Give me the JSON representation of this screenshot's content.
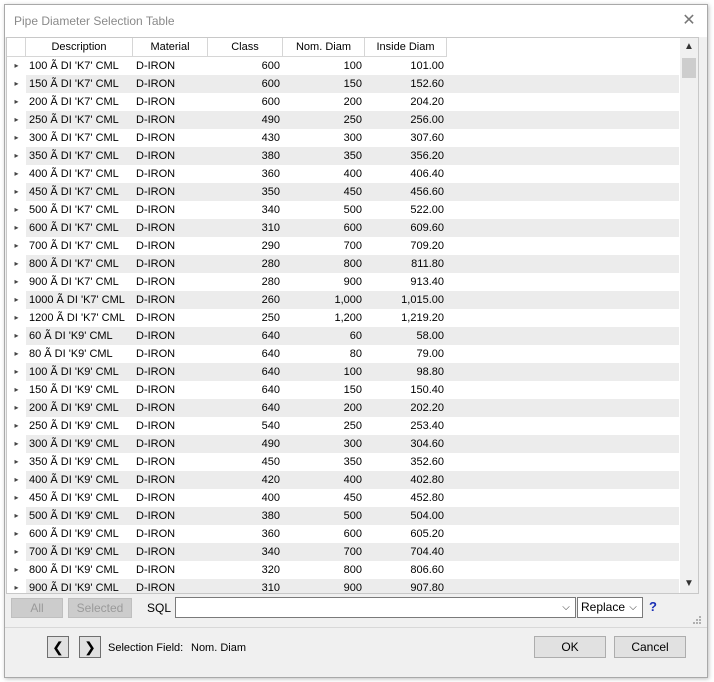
{
  "window": {
    "title": "Pipe Diameter Selection Table",
    "close_glyph": "✕"
  },
  "grid": {
    "columns": [
      "Description",
      "Material",
      "Class",
      "Nom. Diam",
      "Inside Diam"
    ],
    "row_indicator": "▸",
    "rows": [
      {
        "description": "100 Ã DI 'K7' CML",
        "material": "D-IRON",
        "class": "600",
        "nom_diam": "100",
        "inside_diam": "101.00"
      },
      {
        "description": "150 Ã DI 'K7' CML",
        "material": "D-IRON",
        "class": "600",
        "nom_diam": "150",
        "inside_diam": "152.60"
      },
      {
        "description": "200 Ã DI 'K7' CML",
        "material": "D-IRON",
        "class": "600",
        "nom_diam": "200",
        "inside_diam": "204.20"
      },
      {
        "description": "250 Ã DI 'K7' CML",
        "material": "D-IRON",
        "class": "490",
        "nom_diam": "250",
        "inside_diam": "256.00"
      },
      {
        "description": "300 Ã DI 'K7' CML",
        "material": "D-IRON",
        "class": "430",
        "nom_diam": "300",
        "inside_diam": "307.60"
      },
      {
        "description": "350 Ã DI 'K7' CML",
        "material": "D-IRON",
        "class": "380",
        "nom_diam": "350",
        "inside_diam": "356.20"
      },
      {
        "description": "400 Ã DI 'K7' CML",
        "material": "D-IRON",
        "class": "360",
        "nom_diam": "400",
        "inside_diam": "406.40"
      },
      {
        "description": "450 Ã DI 'K7' CML",
        "material": "D-IRON",
        "class": "350",
        "nom_diam": "450",
        "inside_diam": "456.60"
      },
      {
        "description": "500 Ã DI 'K7' CML",
        "material": "D-IRON",
        "class": "340",
        "nom_diam": "500",
        "inside_diam": "522.00"
      },
      {
        "description": "600 Ã DI 'K7' CML",
        "material": "D-IRON",
        "class": "310",
        "nom_diam": "600",
        "inside_diam": "609.60"
      },
      {
        "description": "700 Ã DI 'K7' CML",
        "material": "D-IRON",
        "class": "290",
        "nom_diam": "700",
        "inside_diam": "709.20"
      },
      {
        "description": "800 Ã DI 'K7' CML",
        "material": "D-IRON",
        "class": "280",
        "nom_diam": "800",
        "inside_diam": "811.80"
      },
      {
        "description": "900 Ã DI 'K7' CML",
        "material": "D-IRON",
        "class": "280",
        "nom_diam": "900",
        "inside_diam": "913.40"
      },
      {
        "description": "1000 Ã DI 'K7' CML",
        "material": "D-IRON",
        "class": "260",
        "nom_diam": "1,000",
        "inside_diam": "1,015.00"
      },
      {
        "description": "1200 Ã DI 'K7' CML",
        "material": "D-IRON",
        "class": "250",
        "nom_diam": "1,200",
        "inside_diam": "1,219.20"
      },
      {
        "description": "60 Ã DI 'K9' CML",
        "material": "D-IRON",
        "class": "640",
        "nom_diam": "60",
        "inside_diam": "58.00"
      },
      {
        "description": "80 Ã DI 'K9' CML",
        "material": "D-IRON",
        "class": "640",
        "nom_diam": "80",
        "inside_diam": "79.00"
      },
      {
        "description": "100 Ã DI 'K9' CML",
        "material": "D-IRON",
        "class": "640",
        "nom_diam": "100",
        "inside_diam": "98.80"
      },
      {
        "description": "150 Ã DI 'K9' CML",
        "material": "D-IRON",
        "class": "640",
        "nom_diam": "150",
        "inside_diam": "150.40"
      },
      {
        "description": "200 Ã DI 'K9' CML",
        "material": "D-IRON",
        "class": "640",
        "nom_diam": "200",
        "inside_diam": "202.20"
      },
      {
        "description": "250 Ã DI 'K9' CML",
        "material": "D-IRON",
        "class": "540",
        "nom_diam": "250",
        "inside_diam": "253.40"
      },
      {
        "description": "300 Ã DI 'K9' CML",
        "material": "D-IRON",
        "class": "490",
        "nom_diam": "300",
        "inside_diam": "304.60"
      },
      {
        "description": "350 Ã DI 'K9' CML",
        "material": "D-IRON",
        "class": "450",
        "nom_diam": "350",
        "inside_diam": "352.60"
      },
      {
        "description": "400 Ã DI 'K9' CML",
        "material": "D-IRON",
        "class": "420",
        "nom_diam": "400",
        "inside_diam": "402.80"
      },
      {
        "description": "450 Ã DI 'K9' CML",
        "material": "D-IRON",
        "class": "400",
        "nom_diam": "450",
        "inside_diam": "452.80"
      },
      {
        "description": "500 Ã DI 'K9' CML",
        "material": "D-IRON",
        "class": "380",
        "nom_diam": "500",
        "inside_diam": "504.00"
      },
      {
        "description": "600 Ã DI 'K9' CML",
        "material": "D-IRON",
        "class": "360",
        "nom_diam": "600",
        "inside_diam": "605.20"
      },
      {
        "description": "700 Ã DI 'K9' CML",
        "material": "D-IRON",
        "class": "340",
        "nom_diam": "700",
        "inside_diam": "704.40"
      },
      {
        "description": "800 Ã DI 'K9' CML",
        "material": "D-IRON",
        "class": "320",
        "nom_diam": "800",
        "inside_diam": "806.60"
      },
      {
        "description": "900 Ã DI 'K9' CML",
        "material": "D-IRON",
        "class": "310",
        "nom_diam": "900",
        "inside_diam": "907.80"
      }
    ]
  },
  "filter": {
    "all_label": "All",
    "selected_label": "Selected",
    "sql_label": "SQL",
    "sql_value": "",
    "replace_value": "Replace",
    "help_glyph": "?"
  },
  "bottom": {
    "prev_glyph": "❮",
    "next_glyph": "❯",
    "selection_field_label": "Selection Field:",
    "selection_field_value": "Nom. Diam",
    "ok_label": "OK",
    "cancel_label": "Cancel"
  },
  "colors": {
    "alt_row": "#ececec",
    "help_icon": "#1a2fb5"
  },
  "icons": [
    "close-icon",
    "row-indicator-icon",
    "scroll-up-icon",
    "scroll-down-icon",
    "combo-arrow-icon",
    "help-icon",
    "size-grip-icon",
    "arrow-left-icon",
    "arrow-right-icon"
  ]
}
